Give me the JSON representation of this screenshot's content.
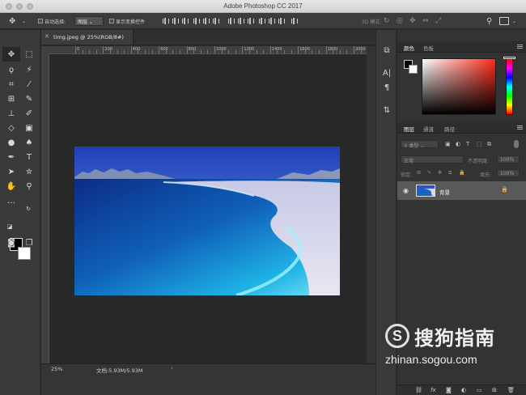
{
  "window": {
    "title": "Adobe Photoshop CC 2017"
  },
  "options_bar": {
    "auto_select_label": "自动选择:",
    "auto_select_value": "图层",
    "show_transform_label": "显示变换控件",
    "mode_3d_label": "3D 模式:"
  },
  "document": {
    "tab_title": "timg.jpeg @ 25%(RGB/8#)",
    "ruler_labels": [
      "0",
      "200",
      "400",
      "600",
      "800",
      "1000",
      "1200",
      "1400",
      "1600",
      "1800",
      "2000"
    ],
    "zoom": "25%",
    "doc_size": "文档:5.93M/5.93M"
  },
  "color_panel": {
    "tabs": [
      "颜色",
      "色板"
    ],
    "foreground": "#000000",
    "background": "#ffffff"
  },
  "layers_panel": {
    "tabs": [
      "图层",
      "通道",
      "路径"
    ],
    "filter_kind": "类型",
    "blend_mode": "正常",
    "opacity_label": "不透明度:",
    "opacity_value": "100%",
    "lock_label": "锁定:",
    "fill_label": "填充:",
    "fill_value": "100%",
    "layers": [
      {
        "name": "背景",
        "locked": true,
        "visible": true
      }
    ],
    "bottom_icons": [
      "link-icon",
      "fx-icon",
      "mask-icon",
      "adjustment-icon",
      "group-icon",
      "new-layer-icon",
      "delete-icon"
    ]
  },
  "tools": [
    "move-tool",
    "marquee-tool",
    "lasso-tool",
    "quick-select-tool",
    "crop-tool",
    "eyedropper-tool",
    "healing-tool",
    "brush-tool",
    "stamp-tool",
    "history-brush-tool",
    "eraser-tool",
    "gradient-tool",
    "blur-tool",
    "dodge-tool",
    "pen-tool",
    "type-tool",
    "path-select-tool",
    "shape-tool",
    "hand-tool",
    "zoom-tool",
    "more-tools",
    "color-swatches",
    "quick-mask",
    "screen-mode"
  ],
  "watermark": {
    "brand": "搜狗指南",
    "url": "zhinan.sogou.com"
  },
  "colors": {
    "app_bg": "#282828",
    "panel_bg": "#333333",
    "selected_layer": "#595959"
  }
}
